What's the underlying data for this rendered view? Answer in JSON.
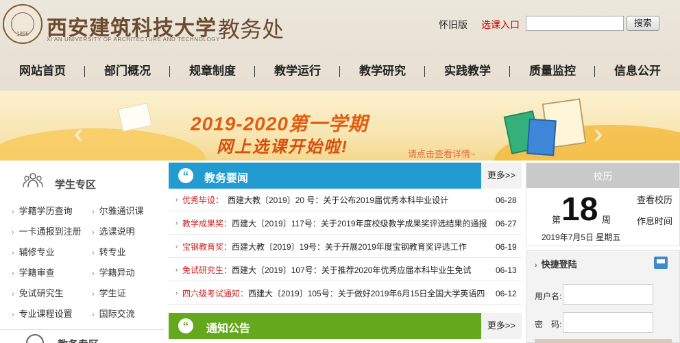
{
  "header": {
    "logo_cn": "西安建筑科技大学",
    "logo_en": "XI'AN UNIVERSITY OF ARCHITECTURE AND TECHNOLOGY",
    "logo_year": "1895",
    "dept": "教务处",
    "link_old": "怀旧版",
    "link_select": "选课入口",
    "search_value": "",
    "search_button": "搜索"
  },
  "nav": [
    {
      "label": "网站首页"
    },
    {
      "label": "部门概况"
    },
    {
      "label": "规章制度"
    },
    {
      "label": "教学运行"
    },
    {
      "label": "教学研究"
    },
    {
      "label": "实践教学"
    },
    {
      "label": "质量监控"
    },
    {
      "label": "信息公开"
    }
  ],
  "banner": {
    "line1": "2019-2020第一学期",
    "line2": "网上选课开始啦!",
    "note": "请点击查看详情~",
    "prev": "‹",
    "next": "›"
  },
  "student_zone": {
    "title": "学生专区",
    "items": [
      {
        "label": "学籍学历查询"
      },
      {
        "label": "尔雅通识课"
      },
      {
        "label": "一卡通报到注册"
      },
      {
        "label": "选课说明"
      },
      {
        "label": "辅修专业"
      },
      {
        "label": "转专业"
      },
      {
        "label": "学籍审查"
      },
      {
        "label": "学籍异动"
      },
      {
        "label": "免试研究生"
      },
      {
        "label": "学生证"
      },
      {
        "label": "专业课程设置"
      },
      {
        "label": "国际交流"
      }
    ],
    "next_section": "教务专区"
  },
  "news": {
    "title": "教务要闻",
    "more": "更多>>",
    "items": [
      {
        "cat": "优秀毕设：",
        "title": "西建大教〔2019〕20 号：关于公布2019届优秀本科毕业设计",
        "date": "06-28"
      },
      {
        "cat": "教学成果奖：",
        "title": "西建大〔2019〕117号：关于2019年度校级教学成果奖评选结果的通报",
        "date": "06-27"
      },
      {
        "cat": "宝钢教育奖：",
        "title": "西建大教〔2019〕19号：关于开展2019年度宝钢教育奖评选工作",
        "date": "06-19"
      },
      {
        "cat": "免试研究生：",
        "title": "西建大〔2019〕107号：关于推荐2020年优秀应届本科毕业生免试",
        "date": "06-13"
      },
      {
        "cat": "四六级考试通知：",
        "title": "西建大〔2019〕105号：关于做好2019年6月15日全国大学英语四",
        "date": "06-12"
      }
    ]
  },
  "notice": {
    "title": "通知公告",
    "more": "更多>>"
  },
  "calendar": {
    "title": "校历",
    "week_pre": "第",
    "week_num": "18",
    "week_post": "周",
    "link_calendar": "查看校历",
    "link_schedule": "作息时间",
    "date": "2019年7月5日  星期五"
  },
  "login": {
    "title": "快捷登陆",
    "user_label": "用户名:",
    "pass_label": "密　码:"
  },
  "colors": {
    "news_blue": "#219bd0",
    "notice_green": "#64a81e",
    "accent_red": "#d12020"
  }
}
